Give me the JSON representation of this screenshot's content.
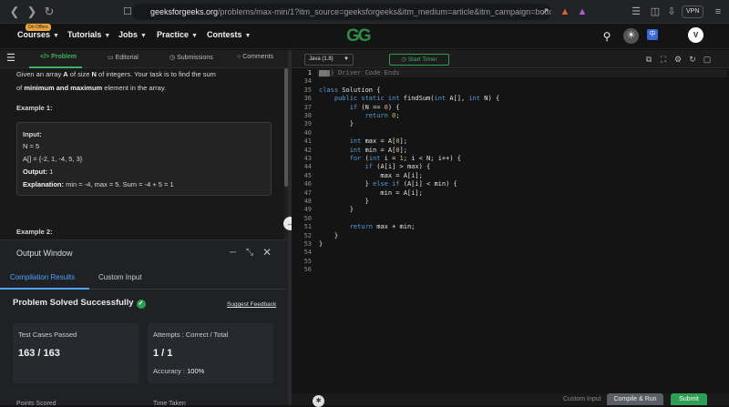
{
  "browser": {
    "url_host": "geeksforgeeks.org",
    "url_rest": "/problems/max-min/1?itm_source=geeksforgeeks&itm_medium=article&itm_campaign=bottom_st...",
    "vpn_label": "VPN"
  },
  "header": {
    "offer_badge": "On Offers",
    "menu": [
      "Courses",
      "Tutorials",
      "Jobs",
      "Practice",
      "Contests"
    ],
    "logo": "GG",
    "avatar_initial": "V"
  },
  "problem_tabs": [
    "Problem",
    "Editorial",
    "Submissions",
    "Comments"
  ],
  "problem": {
    "desc_line1_pre": "Given an array ",
    "desc_A": "A",
    "desc_mid": " of size ",
    "desc_N": "N",
    "desc_line1_post": " of integers. Your task is to find the sum",
    "desc_line2_pre": "of ",
    "desc_line2_bold": "minimum and maximum",
    "desc_line2_post": " element in the array.",
    "example1_title": "Example 1:",
    "example_input_label": "Input:",
    "example_n": "N = 5",
    "example_arr": "A[] = {-2, 1, -4, 5, 3}",
    "example_output_label": "Output:",
    "example_output_value": " 1",
    "example_expl_label": "Explanation:",
    "example_expl_value": " min = -4, max =  5. Sum = -4 + 5 = 1",
    "example2_title": "Example 2:"
  },
  "output_window": {
    "title": "Output Window",
    "tabs": [
      "Compilation Results",
      "Custom Input"
    ],
    "status": "Problem Solved Successfully",
    "feedback": "Suggest Feedback",
    "test_cases_label": "Test Cases Passed",
    "test_cases_value": "163 / 163",
    "attempts_label": "Attempts : Correct / Total",
    "attempts_value": "1 / 1",
    "accuracy_label": "Accuracy :",
    "accuracy_value": "100%",
    "cut_label_left": "Points Scored",
    "cut_label_right": "Time Taken"
  },
  "editor": {
    "language": "Java (1.8)",
    "timer_label": "Start Timer",
    "footer": {
      "custom_input": "Custom Input",
      "compile": "Compile & Run",
      "submit": "Submit"
    },
    "line_numbers": [
      "1",
      "34",
      "35",
      "36",
      "37",
      "38",
      "39",
      "40",
      "41",
      "42",
      "43",
      "44",
      "45",
      "46",
      "47",
      "48",
      "49",
      "50",
      "51",
      "52",
      "53",
      "54",
      "55",
      "56"
    ],
    "code_lines": [
      "// } Driver Code Ends",
      "",
      "class Solution {",
      "    public static int findSum(int A[], int N) {",
      "        if (N == 0) {",
      "            return 0;",
      "        }",
      "",
      "        int max = A[0];",
      "        int min = A[0];",
      "        for (int i = 1; i < N; i++) {",
      "            if (A[i] > max) {",
      "                max = A[i];",
      "            } else if (A[i] < min) {",
      "                min = A[i];",
      "            }",
      "        }",
      "",
      "        return max + min;",
      "    }",
      "}",
      "",
      "",
      ""
    ]
  }
}
